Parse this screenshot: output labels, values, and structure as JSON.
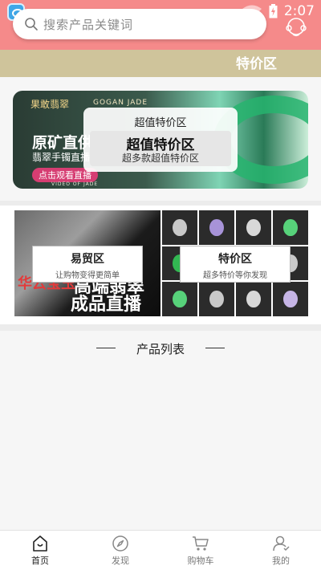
{
  "status_bar": {
    "time": "2:07"
  },
  "search": {
    "placeholder": "搜索产品关键词"
  },
  "section": {
    "title": "特价区"
  },
  "banner": {
    "brand": "果敢翡翠",
    "brand_en": "GOGAN JADE",
    "headline": "原矿直供",
    "subline": "翡翠手镯直播",
    "cta": "点击观看直播",
    "footer": "VIDEO OF JADE",
    "card": {
      "title": "超值特价区",
      "big": "超值特价区",
      "small": "超多款超值特价区"
    }
  },
  "promo": [
    {
      "title": "易贸区",
      "subtitle": "让购物变得更简单",
      "bg_text_1": "华云宝玉",
      "bg_text_2": "高端翡翠",
      "bg_text_3": "成品直播"
    },
    {
      "title": "特价区",
      "subtitle": "超多特价等你发现"
    }
  ],
  "product_list": {
    "title": "产品列表"
  },
  "bottom_nav": {
    "items": [
      {
        "label": "首页",
        "icon": "home-icon",
        "active": true
      },
      {
        "label": "发现",
        "icon": "compass-icon",
        "active": false
      },
      {
        "label": "购物车",
        "icon": "cart-icon",
        "active": false
      },
      {
        "label": "我的",
        "icon": "user-icon",
        "active": false
      }
    ]
  },
  "colors": {
    "header": "#f58a8a",
    "section_bar": "#cfc49b",
    "background": "#f6f6f6",
    "cta": "#d63d72"
  }
}
